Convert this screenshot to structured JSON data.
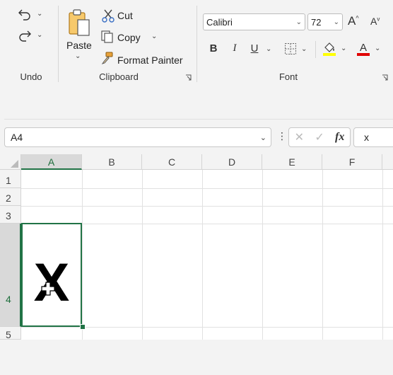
{
  "ribbon": {
    "undo_group": {
      "label": "Undo"
    },
    "clipboard_group": {
      "label": "Clipboard",
      "paste_label": "Paste",
      "cut_label": "Cut",
      "copy_label": "Copy",
      "format_painter_label": "Format Painter"
    },
    "font_group": {
      "label": "Font",
      "font_name": "Calibri",
      "font_size": "72",
      "bold": "B",
      "italic": "I",
      "underline": "U",
      "fill_color": "#ffff00",
      "font_color": "#e00000"
    }
  },
  "formula_bar": {
    "name_box": "A4",
    "formula": "x"
  },
  "grid": {
    "columns": [
      "A",
      "B",
      "C",
      "D",
      "E",
      "F"
    ],
    "rows": [
      "1",
      "2",
      "3",
      "4",
      "5"
    ],
    "selected_cell": "A4",
    "cell_A4_text": "X"
  },
  "colors": {
    "accent": "#217346"
  }
}
